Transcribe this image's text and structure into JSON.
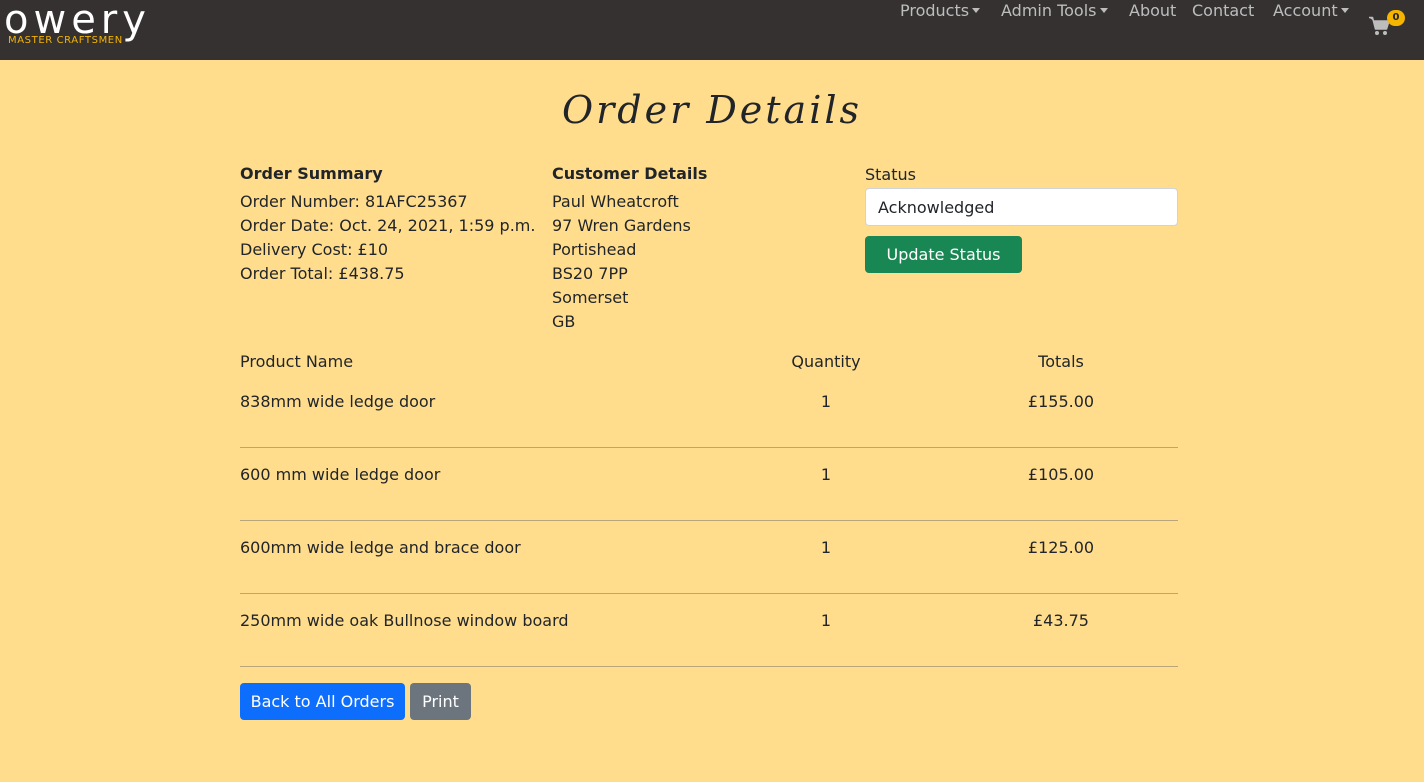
{
  "brand": {
    "name": "owery",
    "tagline": "MASTER CRAFTSMEN"
  },
  "nav": {
    "items": [
      "Products",
      "Admin Tools",
      "About",
      "Contact",
      "Account"
    ],
    "cart_count": "0"
  },
  "page": {
    "title": "Order Details"
  },
  "summary": {
    "heading": "Order Summary",
    "lines": [
      "Order Number: 81AFC25367",
      "Order Date: Oct. 24, 2021, 1:59 p.m.",
      "Delivery Cost: £10",
      "Order Total: £438.75"
    ]
  },
  "customer": {
    "heading": "Customer Details",
    "lines": [
      "Paul Wheatcroft",
      "97 Wren Gardens",
      "Portishead",
      "BS20 7PP",
      "Somerset",
      "GB"
    ]
  },
  "status": {
    "label": "Status",
    "value": "Acknowledged",
    "update_label": "Update Status"
  },
  "table": {
    "headers": [
      "Product Name",
      "Quantity",
      "Totals"
    ],
    "rows": [
      {
        "name": "838mm wide ledge door",
        "qty": "1",
        "total": "£155.00"
      },
      {
        "name": "600 mm wide ledge door",
        "qty": "1",
        "total": "£105.00"
      },
      {
        "name": "600mm wide ledge and brace door",
        "qty": "1",
        "total": "£125.00"
      },
      {
        "name": "250mm wide oak Bullnose window board",
        "qty": "1",
        "total": "£43.75"
      }
    ]
  },
  "actions": {
    "back_label": "Back to All Orders",
    "print_label": "Print"
  },
  "colors": {
    "page_bg": "#ffdd8c",
    "navbar_bg": "#353131",
    "accent": "#f4b400"
  },
  "icons": {
    "cart": "shopping-cart-icon",
    "caret": "caret-down-icon"
  }
}
